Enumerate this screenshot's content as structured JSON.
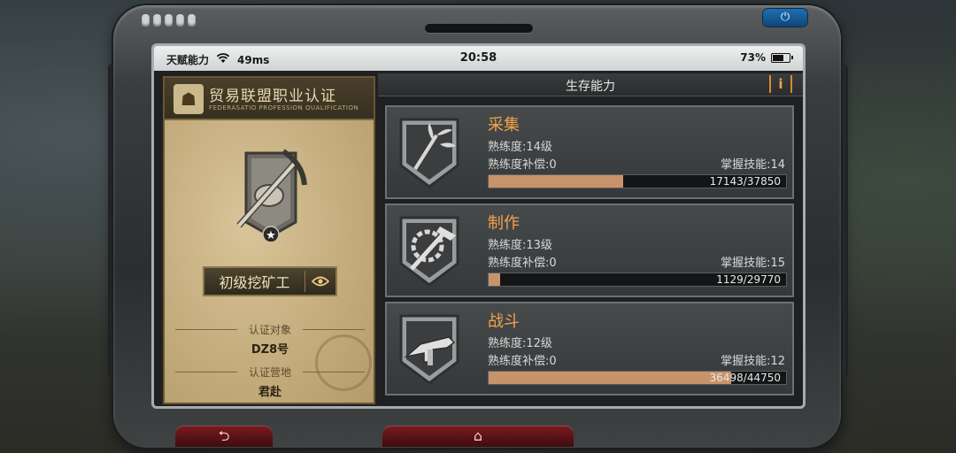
{
  "statusbar": {
    "carrier": "天赋能力",
    "ping": "49ms",
    "time": "20:58",
    "battery": "73%",
    "battery_level": 0.73
  },
  "cert": {
    "title": "贸易联盟职业认证",
    "subtitle": "FEDERASATIO PROFESSION QUALIFICATION",
    "rank": "初级挖矿工",
    "target_label": "认证对象",
    "target_value": "DZ8号",
    "camp_label": "认证营地",
    "camp_value": "君赴"
  },
  "panel": {
    "title": "生存能力",
    "info_label": "i"
  },
  "skills": [
    {
      "name": "采集",
      "level": "熟练度:14级",
      "compensation": "熟练度补偿:0",
      "mastered": "掌握技能:14",
      "progress_text": "17143/37850",
      "current": 17143,
      "max": 37850,
      "icon": "gather-icon"
    },
    {
      "name": "制作",
      "level": "熟练度:13级",
      "compensation": "熟练度补偿:0",
      "mastered": "掌握技能:15",
      "progress_text": "1129/29770",
      "current": 1129,
      "max": 29770,
      "icon": "craft-icon"
    },
    {
      "name": "战斗",
      "level": "熟练度:12级",
      "compensation": "熟练度补偿:0",
      "mastered": "掌握技能:12",
      "progress_text": "36498/44750",
      "current": 36498,
      "max": 44750,
      "icon": "combat-icon"
    }
  ],
  "colors": {
    "accent": "#f2a24b",
    "progress": "#c9936a"
  }
}
